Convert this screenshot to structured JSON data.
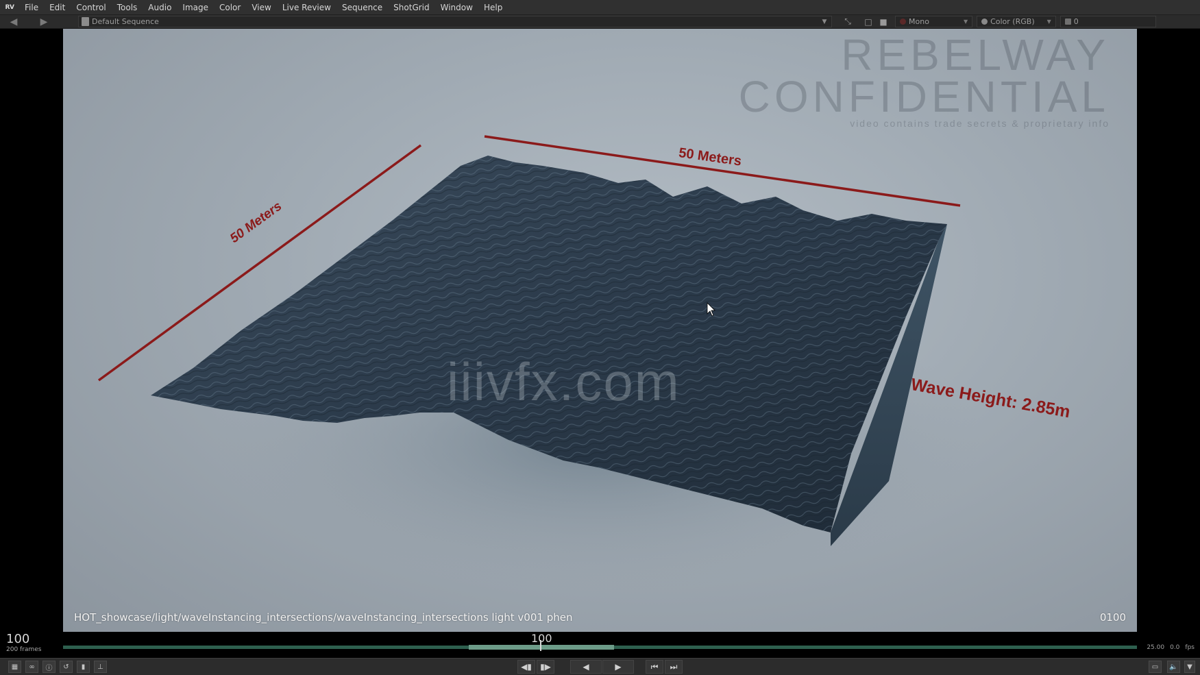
{
  "app": {
    "logo": "RV"
  },
  "menu": [
    "File",
    "Edit",
    "Control",
    "Tools",
    "Audio",
    "Image",
    "Color",
    "View",
    "Live Review",
    "Sequence",
    "ShotGrid",
    "Window",
    "Help"
  ],
  "toolbar": {
    "sequence": "Default Sequence",
    "stereo": "Mono",
    "color_mode": "Color (RGB)",
    "layer": "0"
  },
  "viewer": {
    "watermark": "iiivfx.com",
    "confidential_line1": "REBELWAY",
    "confidential_line2": "CONFIDENTIAL",
    "confidential_line3": "video contains trade secrets & proprietary info",
    "label_left": "50 Meters",
    "label_top": "50 Meters",
    "label_wave": "Wave Height: 2.85m",
    "path": "HOT_showcase/light/waveInstancing_intersections/waveInstancing_intersections light v001 phen",
    "frame": "0100"
  },
  "timeline": {
    "current_frame": "100",
    "frame_count": "200 frames",
    "playhead_frame": "100",
    "fps": "25.00",
    "offset": "0.0",
    "fps_label": "fps"
  },
  "colors": {
    "annotation": "#8b1a1a",
    "track": "#2e5f4e",
    "track_range": "#6d9c89"
  }
}
